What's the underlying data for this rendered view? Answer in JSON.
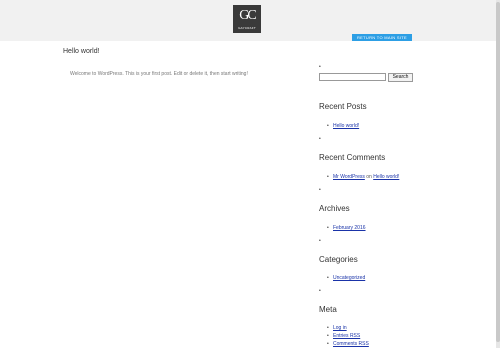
{
  "header": {
    "logo_mark": "GC",
    "logo_text": "GAYCRAFT",
    "return_button": "RETURN TO MAIN SITE"
  },
  "post": {
    "title": "Hello world!",
    "body": "Welcome to WordPress. This is your first post. Edit or delete it, then start writing!"
  },
  "sidebar": {
    "search": {
      "value": "",
      "placeholder": "",
      "button": "Search"
    },
    "recent_posts": {
      "title": "Recent Posts",
      "items": [
        "Hello world!"
      ]
    },
    "recent_comments": {
      "title": "Recent Comments",
      "author": "Mr WordPress",
      "on": "on",
      "post": "Hello world!"
    },
    "archives": {
      "title": "Archives",
      "items": [
        "February 2016"
      ]
    },
    "categories": {
      "title": "Categories",
      "items": [
        "Uncategorized"
      ]
    },
    "meta": {
      "title": "Meta",
      "items": [
        "Log in",
        "Entries RSS",
        "Comments RSS"
      ]
    }
  },
  "colors": {
    "accent": "#2d9fe5",
    "header_bg": "#f1f1f1",
    "link": "#1a33a8"
  }
}
